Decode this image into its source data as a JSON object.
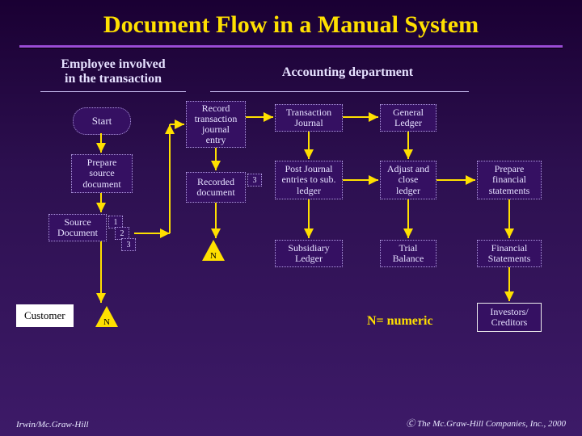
{
  "title": "Document Flow in a Manual System",
  "headers": {
    "left": "Employee involved\nin the transaction",
    "right": "Accounting department"
  },
  "nodes": {
    "start": "Start",
    "prepare_source": "Prepare source document",
    "source_document": "Source Document",
    "record_entry": "Record transaction journal entry",
    "recorded_doc": "Recorded document",
    "numN": "N",
    "num1": "1",
    "num2": "2",
    "num3": "3",
    "recorded_num3": "3",
    "trans_journal": "Transaction Journal",
    "post_entries": "Post Journal entries to sub. ledger",
    "sub_ledger": "Subsidiary Ledger",
    "gen_ledger": "General Ledger",
    "adjust_close": "Adjust and close ledger",
    "trial_balance": "Trial Balance",
    "prepare_fs": "Prepare financial statements",
    "fin_statements": "Financial Statements",
    "investors": "Investors/ Creditors"
  },
  "customer": "Customer",
  "legend": "N= numeric",
  "footer": {
    "left": "Irwin/Mc.Graw-Hill",
    "right": "Ⓒ The Mc.Graw-Hill Companies, Inc., 2000"
  },
  "chart_data": {
    "type": "diagram",
    "title": "Document Flow in a Manual System",
    "lanes": [
      {
        "name": "Employee involved in the transaction",
        "nodes": [
          "start",
          "prepare_source",
          "source_document",
          "customer_file"
        ]
      },
      {
        "name": "Accounting department",
        "nodes": [
          "record_entry",
          "recorded_doc",
          "file_N",
          "trans_journal",
          "post_entries",
          "sub_ledger",
          "gen_ledger",
          "adjust_close",
          "trial_balance",
          "prepare_fs",
          "fin_statements",
          "investors"
        ]
      }
    ],
    "nodes": [
      {
        "id": "start",
        "label": "Start",
        "shape": "terminator"
      },
      {
        "id": "prepare_source",
        "label": "Prepare source document",
        "shape": "process"
      },
      {
        "id": "source_document",
        "label": "Source Document",
        "shape": "document",
        "copies": [
          1,
          2,
          3
        ]
      },
      {
        "id": "customer_file",
        "label": "Customer",
        "shape": "offpage"
      },
      {
        "id": "record_entry",
        "label": "Record transaction journal entry",
        "shape": "process"
      },
      {
        "id": "recorded_doc",
        "label": "Recorded document",
        "shape": "document",
        "copies": [
          3
        ]
      },
      {
        "id": "file_N",
        "label": "N",
        "shape": "file-triangle",
        "note": "N = numeric"
      },
      {
        "id": "trans_journal",
        "label": "Transaction Journal",
        "shape": "document"
      },
      {
        "id": "post_entries",
        "label": "Post Journal entries to sub. ledger",
        "shape": "process"
      },
      {
        "id": "sub_ledger",
        "label": "Subsidiary Ledger",
        "shape": "document"
      },
      {
        "id": "gen_ledger",
        "label": "General Ledger",
        "shape": "document"
      },
      {
        "id": "adjust_close",
        "label": "Adjust and close ledger",
        "shape": "process"
      },
      {
        "id": "trial_balance",
        "label": "Trial Balance",
        "shape": "document"
      },
      {
        "id": "prepare_fs",
        "label": "Prepare financial statements",
        "shape": "process"
      },
      {
        "id": "fin_statements",
        "label": "Financial Statements",
        "shape": "document"
      },
      {
        "id": "investors",
        "label": "Investors/ Creditors",
        "shape": "offpage"
      }
    ],
    "edges": [
      [
        "start",
        "prepare_source"
      ],
      [
        "prepare_source",
        "source_document"
      ],
      [
        "source_document",
        "record_entry"
      ],
      [
        "source_document",
        "customer_file"
      ],
      [
        "record_entry",
        "recorded_doc"
      ],
      [
        "recorded_doc",
        "file_N"
      ],
      [
        "record_entry",
        "trans_journal"
      ],
      [
        "trans_journal",
        "post_entries"
      ],
      [
        "trans_journal",
        "gen_ledger"
      ],
      [
        "post_entries",
        "sub_ledger"
      ],
      [
        "post_entries",
        "adjust_close"
      ],
      [
        "gen_ledger",
        "adjust_close"
      ],
      [
        "adjust_close",
        "trial_balance"
      ],
      [
        "adjust_close",
        "prepare_fs"
      ],
      [
        "prepare_fs",
        "fin_statements"
      ],
      [
        "fin_statements",
        "investors"
      ]
    ],
    "legend": "N = numeric"
  }
}
